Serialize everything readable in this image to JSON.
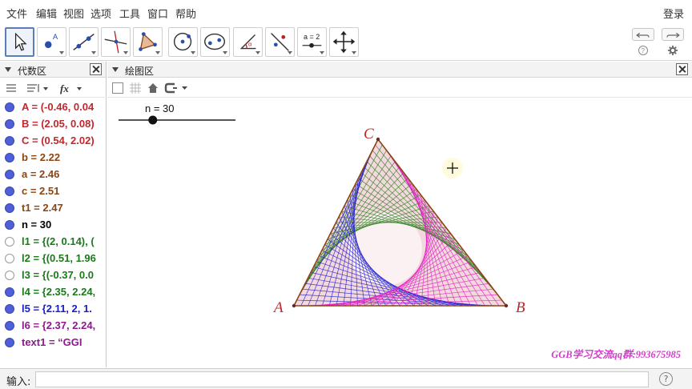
{
  "menu": [
    "文件",
    "编辑",
    "视图",
    "选项",
    "工具",
    "窗口",
    "帮助"
  ],
  "login_label": "登录",
  "tools": [
    {
      "name": "move-tool-button",
      "icon": "cursor-arrow-icon",
      "selected": true
    },
    {
      "name": "point-tool-button",
      "icon": "point-icon"
    },
    {
      "name": "line-tool-button",
      "icon": "line-through-points-icon"
    },
    {
      "name": "perpendicular-tool-button",
      "icon": "perpendicular-line-icon"
    },
    {
      "name": "polygon-tool-button",
      "icon": "polygon-icon"
    },
    {
      "name": "circle-tool-button",
      "icon": "circle-center-point-icon"
    },
    {
      "name": "conic-tool-button",
      "icon": "ellipse-icon"
    },
    {
      "name": "angle-tool-button",
      "icon": "angle-icon"
    },
    {
      "name": "reflect-tool-button",
      "icon": "reflect-line-icon"
    },
    {
      "name": "slider-tool-button",
      "icon": "slider-icon",
      "label": "a = 2"
    },
    {
      "name": "move-view-tool-button",
      "icon": "move-graphics-view-icon"
    }
  ],
  "algebra": {
    "title": "代数区",
    "items": [
      {
        "text": "A = (-0.46, 0.04",
        "color": "#c0282d",
        "filled": true
      },
      {
        "text": "B = (2.05, 0.08)",
        "color": "#c0282d",
        "filled": true
      },
      {
        "text": "C = (0.54, 2.02)",
        "color": "#c0282d",
        "filled": true
      },
      {
        "text": "b = 2.22",
        "color": "#8b4513",
        "filled": true
      },
      {
        "text": "a = 2.46",
        "color": "#8b4513",
        "filled": true
      },
      {
        "text": "c = 2.51",
        "color": "#8b4513",
        "filled": true
      },
      {
        "text": "t1 = 2.47",
        "color": "#8b4513",
        "filled": true
      },
      {
        "text": "n = 30",
        "color": "#000000",
        "filled": true
      },
      {
        "text": "l1 = {(2, 0.14), (",
        "color": "#1a7a1a",
        "filled": false
      },
      {
        "text": "l2 = {(0.51, 1.96",
        "color": "#1a7a1a",
        "filled": false
      },
      {
        "text": "l3 = {(-0.37, 0.0",
        "color": "#1a7a1a",
        "filled": false
      },
      {
        "text": "l4 = {2.35, 2.24,",
        "color": "#1a7a1a",
        "filled": true
      },
      {
        "text": "l5 = {2.11, 2, 1.",
        "color": "#1a1ad0",
        "filled": true
      },
      {
        "text": "l6 = {2.37, 2.24,",
        "color": "#8b1a8b",
        "filled": true
      },
      {
        "text": "text1 = “GGI",
        "color": "#8b1a8b",
        "filled": true
      }
    ]
  },
  "graphics": {
    "title": "绘图区",
    "slider_label": "n = 30",
    "slider_value": 30,
    "slider_min": 1,
    "slider_max": 100,
    "point_labels": {
      "A": "A",
      "B": "B",
      "C": "C"
    },
    "watermark": "GGB学习交流qq群:993675985",
    "colors": {
      "green": "#2e7d1e",
      "blue": "#2020d0",
      "magenta": "#e020c0",
      "fill": "#f3d8de",
      "edge": "#8b4513",
      "label": "#c0282d"
    }
  },
  "input": {
    "label": "输入:",
    "value": "",
    "help": "?"
  }
}
